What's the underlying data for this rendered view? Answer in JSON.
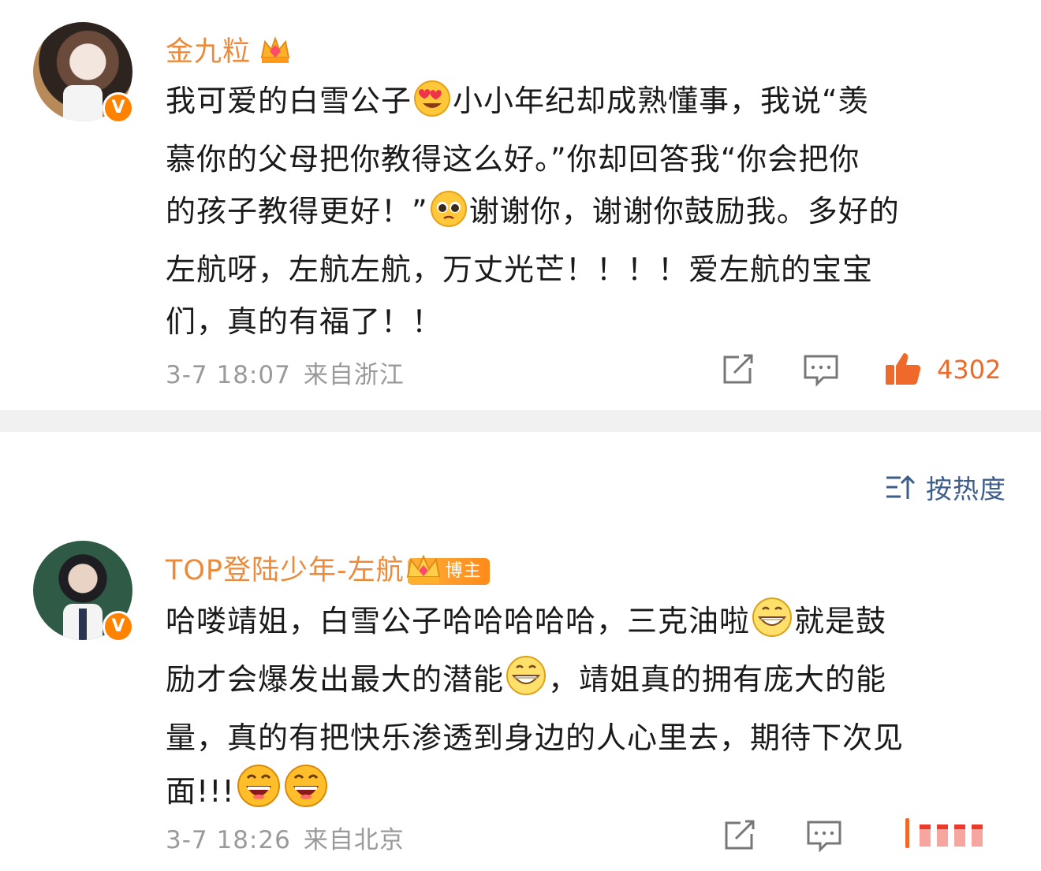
{
  "comments": [
    {
      "username": "金九粒",
      "verified_badge": "v-badge",
      "username_badge": "crown-icon",
      "lines": [
        [
          "我可爱的白雪公子",
          "heart-eyes-emoji",
          "小小年纪却成熟懂事，我说“羡"
        ],
        [
          "慕你的父母把你教得这么好。”你却回答我“你会把你"
        ],
        [
          "的孩子教得更好！”",
          "pleading-emoji",
          "谢谢你，谢谢你鼓励我。多好的"
        ],
        [
          "左航呀，左航左航，万丈光芒！！！！爱左航的宝宝"
        ],
        [
          "们，真的有福了！！"
        ]
      ],
      "time": "3-7 18:07",
      "location": "来自浙江",
      "like_count": "4302"
    },
    {
      "username": "TOP登陆少年-左航",
      "verified_badge": "v-badge",
      "username_badge": "博主",
      "lines": [
        [
          "哈喽靖姐，白雪公子哈哈哈哈哈，三克油啦",
          "grin-emoji",
          "就是鼓"
        ],
        [
          "励才会爆发出最大的潜能",
          "grin-emoji",
          "，靖姐真的拥有庞大的能"
        ],
        [
          "量，真的有把快乐渗透到身边的人心里去，期待下次见"
        ],
        [
          "面!!!",
          "laugh-emoji",
          "laugh-emoji"
        ]
      ],
      "time": "3-7 18:26",
      "location": "来自北京"
    }
  ],
  "sort": {
    "label": "按热度",
    "icon": "sort-icon"
  },
  "colors": {
    "username": "#ec8a3a",
    "like": "#ec6a2a",
    "link": "#3d5d8a",
    "meta": "#9a9a9a"
  }
}
